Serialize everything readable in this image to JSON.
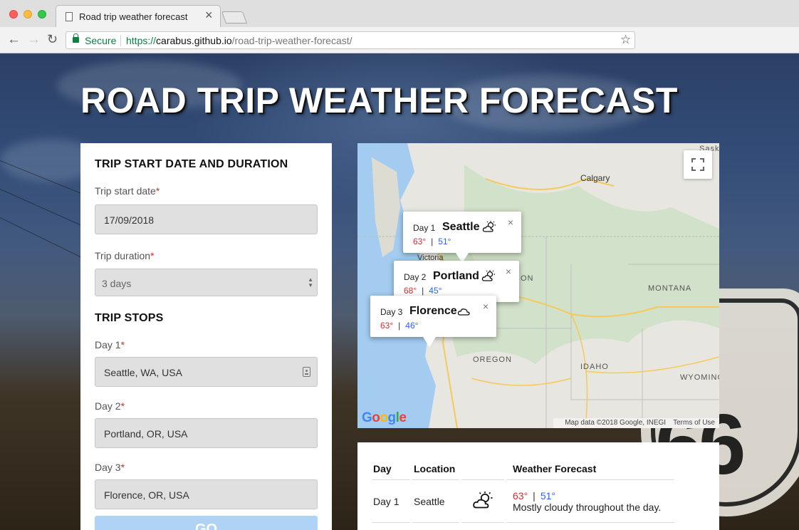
{
  "browser": {
    "tab_title": "Road trip weather forecast",
    "tab_close": "×",
    "secure_label": "Secure",
    "url_scheme": "https://",
    "url_host": "carabus.github.io",
    "url_path": "/road-trip-weather-forecast/",
    "back": "←",
    "forward": "→",
    "reload": "↻",
    "bookmark": "☆"
  },
  "page": {
    "title": "ROAD TRIP WEATHER FORECAST"
  },
  "form": {
    "start_section": "TRIP START DATE AND DURATION",
    "start_date_label": "Trip start date",
    "start_date_value": "17/09/2018",
    "duration_label": "Trip duration",
    "duration_value": "3 days",
    "required_mark": "*",
    "stops_section": "TRIP STOPS",
    "stops": [
      {
        "label": "Day 1",
        "value": "Seattle, WA, USA"
      },
      {
        "label": "Day 2",
        "value": "Portland, OR, USA"
      },
      {
        "label": "Day 3",
        "value": "Florence, OR, USA"
      }
    ],
    "submit_label": "GO"
  },
  "map": {
    "cities": [
      "Calgary",
      "Victoria"
    ],
    "regions": [
      "MONTANA",
      "OREGON",
      "IDAHO",
      "WYOMING",
      "ON",
      "Saska"
    ],
    "attribution": "Map data ©2018 Google, INEGI",
    "terms": "Terms of Use",
    "info_windows": [
      {
        "day": "Day 1",
        "city": "Seattle",
        "hi": "63°",
        "lo": "51°",
        "separator": "|",
        "icon": "partly-cloudy-day-icon"
      },
      {
        "day": "Day 2",
        "city": "Portland",
        "hi": "68°",
        "lo": "45°",
        "separator": "|",
        "icon": "partly-cloudy-day-icon"
      },
      {
        "day": "Day 3",
        "city": "Florence",
        "hi": "63°",
        "lo": "46°",
        "separator": "|",
        "icon": "cloudy-icon"
      }
    ],
    "close_glyph": "×"
  },
  "forecast": {
    "headers": [
      "Day",
      "Location",
      "Weather Forecast"
    ],
    "rows": [
      {
        "day": "Day 1",
        "location": "Seattle",
        "hi": "63°",
        "lo": "51°",
        "separator": "|",
        "summary": "Mostly cloudy throughout the day.",
        "icon": "partly-cloudy-day-icon"
      }
    ]
  },
  "colors": {
    "high_temp": "#d32f2f",
    "low_temp": "#2962ff",
    "secure_green": "#0b8043",
    "go_button": "#aed3f5"
  }
}
